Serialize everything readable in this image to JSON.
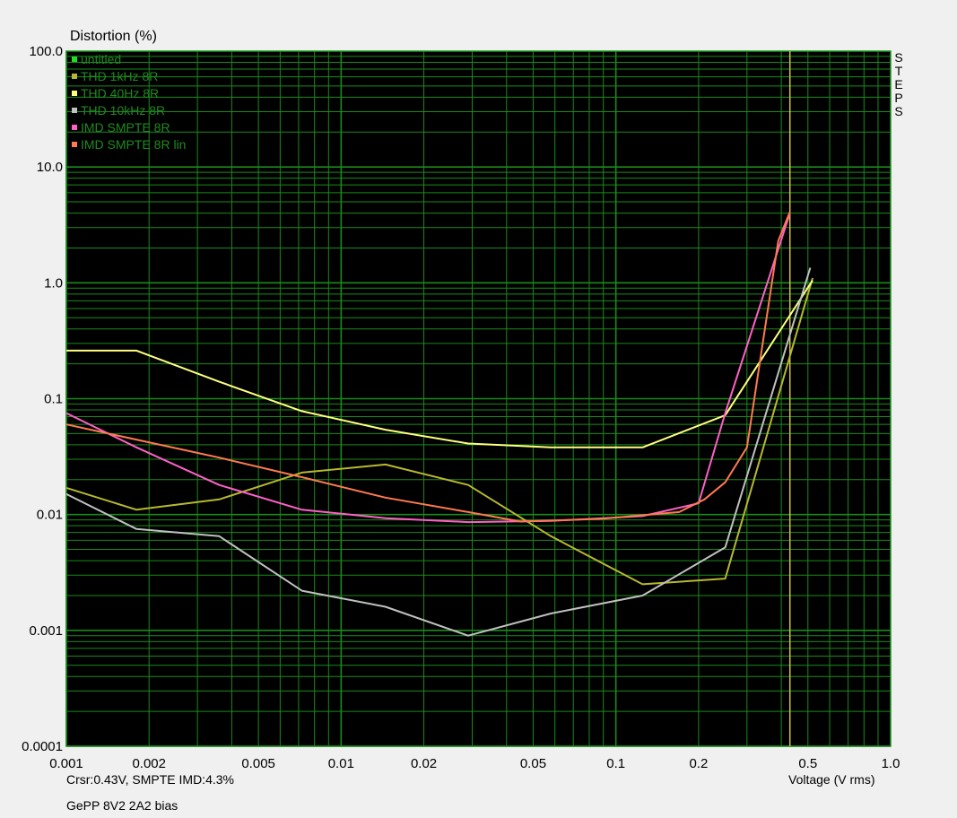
{
  "chart_data": {
    "type": "line",
    "title": "Distortion (%)",
    "xlabel": "Voltage (V rms)",
    "ylabel": "Distortion (%)",
    "xscale": "log",
    "yscale": "log",
    "xlim": [
      0.001,
      1.0
    ],
    "ylim": [
      0.0001,
      100.0
    ],
    "grid": true,
    "legend_position": "top-left",
    "x_ticks": [
      {
        "value": 0.001,
        "label": "0.001"
      },
      {
        "value": 0.002,
        "label": "0.002"
      },
      {
        "value": 0.005,
        "label": "0.005"
      },
      {
        "value": 0.01,
        "label": "0.01"
      },
      {
        "value": 0.02,
        "label": "0.02"
      },
      {
        "value": 0.05,
        "label": "0.05"
      },
      {
        "value": 0.1,
        "label": "0.1"
      },
      {
        "value": 0.2,
        "label": "0.2"
      },
      {
        "value": 0.5,
        "label": "0.5"
      },
      {
        "value": 1.0,
        "label": "1.0"
      }
    ],
    "y_ticks": [
      {
        "value": 100,
        "label": "100.0"
      },
      {
        "value": 10,
        "label": "10.0"
      },
      {
        "value": 1,
        "label": "1.0"
      },
      {
        "value": 0.1,
        "label": "0.1"
      },
      {
        "value": 0.01,
        "label": "0.01"
      },
      {
        "value": 0.001,
        "label": "0.001"
      },
      {
        "value": 0.0001,
        "label": "0.0001"
      }
    ],
    "cursor_x": 0.43,
    "series": [
      {
        "name": "untitled",
        "color": "#22dd22",
        "x": [],
        "y": []
      },
      {
        "name": "THD 1kHz 8R",
        "color": "#b8b830",
        "x": [
          0.001,
          0.0018,
          0.0036,
          0.0072,
          0.0145,
          0.029,
          0.058,
          0.125,
          0.25,
          0.52
        ],
        "y": [
          0.017,
          0.011,
          0.0135,
          0.023,
          0.027,
          0.018,
          0.0065,
          0.0025,
          0.0028,
          1.1
        ]
      },
      {
        "name": "THD 40Hz 8R",
        "color": "#ffff80",
        "x": [
          0.001,
          0.0018,
          0.0036,
          0.0072,
          0.0145,
          0.029,
          0.058,
          0.125,
          0.25,
          0.52
        ],
        "y": [
          0.26,
          0.26,
          0.14,
          0.078,
          0.054,
          0.041,
          0.038,
          0.038,
          0.072,
          1.05
        ]
      },
      {
        "name": "THD 10kHz 8R",
        "color": "#c0c0c0",
        "x": [
          0.001,
          0.0018,
          0.0036,
          0.0072,
          0.0145,
          0.029,
          0.058,
          0.125,
          0.25,
          0.51
        ],
        "y": [
          0.015,
          0.0075,
          0.0065,
          0.0022,
          0.0016,
          0.0009,
          0.0014,
          0.002,
          0.0052,
          1.35
        ]
      },
      {
        "name": "IMD SMPTE 8R",
        "color": "#ff60c8",
        "x": [
          0.001,
          0.0018,
          0.0036,
          0.0072,
          0.0145,
          0.029,
          0.058,
          0.125,
          0.2,
          0.25,
          0.43
        ],
        "y": [
          0.075,
          0.038,
          0.018,
          0.011,
          0.0093,
          0.0086,
          0.0088,
          0.0097,
          0.0125,
          0.075,
          4.0
        ]
      },
      {
        "name": "IMD SMPTE 8R lin",
        "color": "#ff7a50",
        "x": [
          0.001,
          0.0036,
          0.0072,
          0.0145,
          0.029,
          0.045,
          0.09,
          0.17,
          0.21,
          0.25,
          0.3,
          0.39,
          0.43
        ],
        "y": [
          0.06,
          0.031,
          0.021,
          0.014,
          0.0105,
          0.0087,
          0.0092,
          0.0105,
          0.0135,
          0.019,
          0.038,
          2.3,
          4.1
        ]
      }
    ]
  },
  "status": {
    "cursor_readout": "Crsr:0.43V, SMPTE IMD:4.3%",
    "footer_note": "GePP 8V2 2A2 bias",
    "side_label": [
      "S",
      "T",
      "E",
      "P",
      "S"
    ]
  }
}
